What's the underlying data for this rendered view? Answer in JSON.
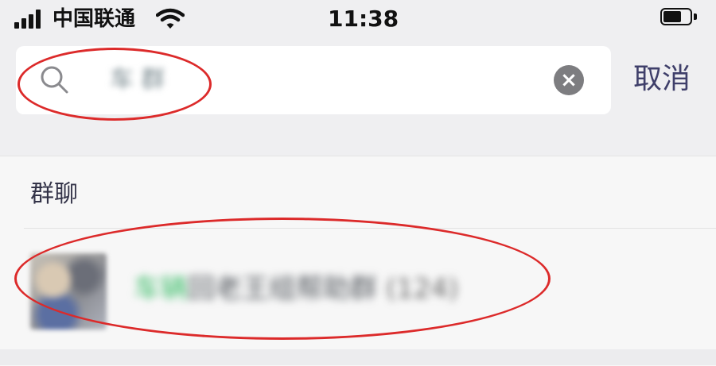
{
  "status_bar": {
    "carrier": "中国联通",
    "time": "11:38",
    "signal_icon": "signal-bars-icon",
    "wifi_icon": "wifi-icon",
    "battery_icon": "battery-icon"
  },
  "search": {
    "value": "车 群",
    "clear_icon": "close-circle-icon",
    "cancel_label": "取消"
  },
  "results": {
    "section_title": "群聊",
    "items": [
      {
        "name_highlight": "车辆",
        "name_rest": "回老王组帮助群",
        "count": "(124)"
      }
    ]
  },
  "annotation_color": "#dc2a2a"
}
